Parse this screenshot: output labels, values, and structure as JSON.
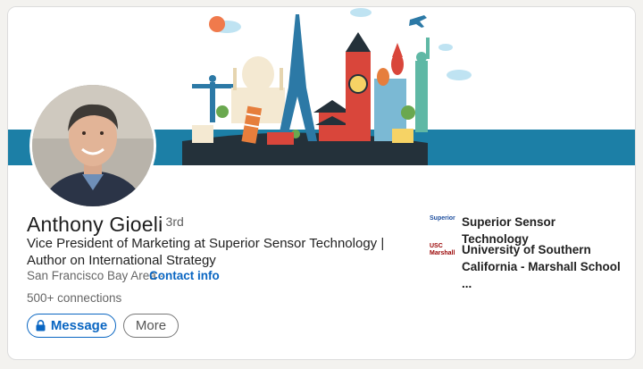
{
  "profile": {
    "name": "Anthony Gioeli",
    "degree": "· 3rd",
    "headline": "Vice President of Marketing at Superior Sensor Technology | Author on International Strategy",
    "location": "San Francisco Bay Area ·",
    "contact_label": "Contact info",
    "connections": "500+ connections"
  },
  "actions": {
    "message_label": "Message",
    "more_label": "More"
  },
  "orgs": [
    {
      "name": "Superior Sensor Technology",
      "logo_text": "Superior",
      "logo_color": "#1d4e9e"
    },
    {
      "name": "University of Southern California - Marshall School ...",
      "logo_text": "USC Marshall",
      "logo_color": "#990000"
    }
  ],
  "colors": {
    "accent": "#0a66c2",
    "banner_sea": "#1c7fa6"
  }
}
